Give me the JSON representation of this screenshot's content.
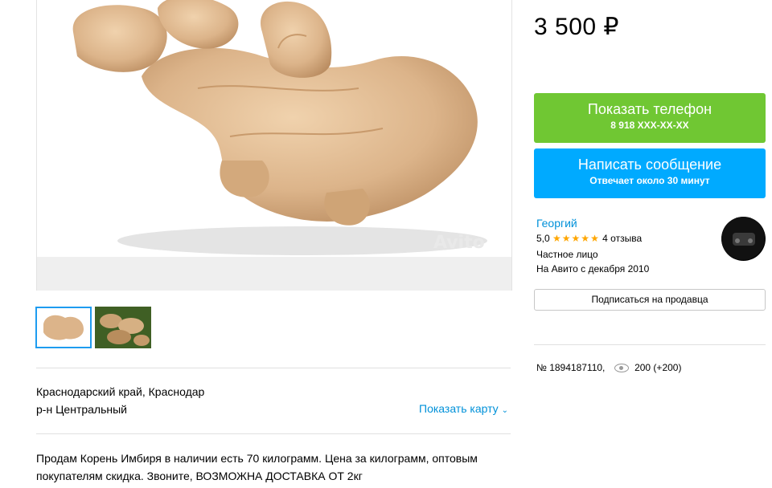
{
  "photo": {
    "watermark": "Avito"
  },
  "location": {
    "line1": "Краснодарский край, Краснодар",
    "line2": "р-н Центральный",
    "map_link": "Показать карту"
  },
  "description": "Продам Корень Имбиря в наличии есть 70 килограмм. Цена за килограмм, оптовым покупателям скидка. Звоните, ВОЗМОЖНА ДОСТАВКА ОТ 2кг",
  "price": "3 500 ₽",
  "phone_button": {
    "label": "Показать телефон",
    "number": "8 918 XXX-XX-XX",
    "color": "#70c733"
  },
  "message_button": {
    "label": "Написать сообщение",
    "note": "Отвечает около 30 минут",
    "color": "#00aaff"
  },
  "seller": {
    "name": "Георгий",
    "rating": "5,0",
    "stars": "★★★★★",
    "reviews": "4 отзыва",
    "type": "Частное лицо",
    "since": "На Авито с декабря 2010"
  },
  "subscribe_label": "Подписаться на продавца",
  "listing": {
    "number": "№ 1894187110,",
    "views": "200 (+200)"
  }
}
